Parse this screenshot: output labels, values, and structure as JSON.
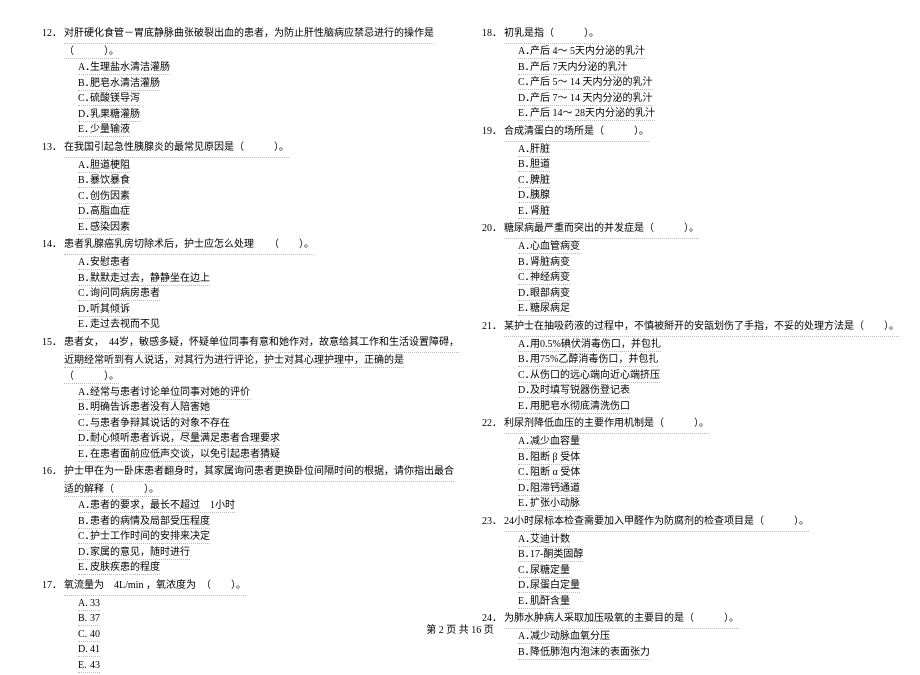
{
  "footer": "第 2 页 共 16 页",
  "left_questions": [
    {
      "num": "12．",
      "text": "对肝硬化食管－胃底静脉曲张破裂出血的患者，为防止肝性脑病应禁忌进行的操作是",
      "text2": "（　　　）。",
      "opts": [
        {
          "l": "A．",
          "t": "生理盐水清洁灌肠"
        },
        {
          "l": "B．",
          "t": "肥皂水清洁灌肠"
        },
        {
          "l": "C．",
          "t": "硫酸镁导泻"
        },
        {
          "l": "D．",
          "t": "乳果糖灌肠"
        },
        {
          "l": "E．",
          "t": "少量输液"
        }
      ]
    },
    {
      "num": "13．",
      "text": "在我国引起急性胰腺炎的最常见原因是（　　　）。",
      "opts": [
        {
          "l": "A．",
          "t": "胆道梗阻"
        },
        {
          "l": "B．",
          "t": "暴饮暴食"
        },
        {
          "l": "C．",
          "t": "创伤因素"
        },
        {
          "l": "D．",
          "t": "高脂血症"
        },
        {
          "l": "E．",
          "t": "感染因素"
        }
      ]
    },
    {
      "num": "14．",
      "text": "患者乳腺癌乳房切除术后，护士应怎么处理　　（　　）。",
      "opts": [
        {
          "l": "A．",
          "t": "安慰患者"
        },
        {
          "l": "B．",
          "t": "默默走过去，静静坐在边上"
        },
        {
          "l": "C．",
          "t": "询问同病房患者"
        },
        {
          "l": "D．",
          "t": "听其倾诉"
        },
        {
          "l": "E．",
          "t": "走过去视而不见"
        }
      ]
    },
    {
      "num": "15．",
      "text": "患者女，　44岁，敏感多疑，怀疑单位同事有意和她作对，故意给其工作和生活设置障碍，",
      "text2": "近期经常听到有人说话，对其行为进行评论，护士对其心理护理中，正确的是（　　　）。",
      "opts": [
        {
          "l": "A．",
          "t": "经常与患者讨论单位同事对她的评价"
        },
        {
          "l": "B．",
          "t": "明确告诉患者没有人陪害她"
        },
        {
          "l": "C．",
          "t": "与患者争辩其说话的对象不存在"
        },
        {
          "l": "D．",
          "t": "耐心倾听患者诉说，尽量满足患者合理要求"
        },
        {
          "l": "E．",
          "t": "在患者面前应低声交谈，以免引起患者猜疑"
        }
      ]
    },
    {
      "num": "16．",
      "text": "护士甲在为一卧床患者翻身时，其家属询问患者更换卧位间隔时间的根据，请你指出最合",
      "text2": "适的解释（　　　）。",
      "opts": [
        {
          "l": "A．",
          "t": "患者的要求，最长不超过　1小时"
        },
        {
          "l": "B．",
          "t": "患者的病情及局部受压程度"
        },
        {
          "l": "C．",
          "t": "护士工作时间的安排来决定"
        },
        {
          "l": "D．",
          "t": "家属的意见，随时进行"
        },
        {
          "l": "E．",
          "t": "皮肤疾患的程度"
        }
      ]
    },
    {
      "num": "17．",
      "text": "氧流量为　4L/min ，氧浓度为　（　　）。",
      "opts": [
        {
          "l": "A.",
          "t": "33"
        },
        {
          "l": "B.",
          "t": "37"
        },
        {
          "l": "C.",
          "t": "40"
        },
        {
          "l": "D.",
          "t": "41"
        },
        {
          "l": "E.",
          "t": "43"
        }
      ]
    }
  ],
  "right_questions": [
    {
      "num": "18．",
      "text": "初乳是指（　　　）。",
      "opts": [
        {
          "l": "A．",
          "t": "产后 4～ 5天内分泌的乳汁"
        },
        {
          "l": "B．",
          "t": "产后 7天内分泌的乳汁"
        },
        {
          "l": "C．",
          "t": "产后 5～ 14 天内分泌的乳汁"
        },
        {
          "l": "D．",
          "t": "产后 7～ 14 天内分泌的乳汁"
        },
        {
          "l": "E．",
          "t": "产后 14～ 28天内分泌的乳汁"
        }
      ]
    },
    {
      "num": "19．",
      "text": "合成清蛋白的场所是（　　　）。",
      "opts": [
        {
          "l": "A．",
          "t": "肝脏"
        },
        {
          "l": "B．",
          "t": "胆道"
        },
        {
          "l": "C．",
          "t": "脾脏"
        },
        {
          "l": "D．",
          "t": "胰腺"
        },
        {
          "l": "E．",
          "t": "肾脏"
        }
      ]
    },
    {
      "num": "20．",
      "text": "糖尿病最严重而突出的并发症是（　　　）。",
      "opts": [
        {
          "l": "A．",
          "t": "心血管病变"
        },
        {
          "l": "B．",
          "t": "肾脏病变"
        },
        {
          "l": "C．",
          "t": "神经病变"
        },
        {
          "l": "D．",
          "t": "眼部病变"
        },
        {
          "l": "E．",
          "t": "糖尿病足"
        }
      ]
    },
    {
      "num": "21．",
      "text": "某护士在抽吸药液的过程中，不慎被掰开的安瓿划伤了手指，不妥的处理方法是（　　）。",
      "opts": [
        {
          "l": "A．",
          "t": "用0.5%碘伏消毒伤口，并包扎"
        },
        {
          "l": "B．",
          "t": "用75%乙醇消毒伤口，并包扎"
        },
        {
          "l": "C．",
          "t": "从伤口的远心端向近心端挤压"
        },
        {
          "l": "D．",
          "t": "及时填写锐器伤登记表"
        },
        {
          "l": "E．",
          "t": "用肥皂水彻底清洗伤口"
        }
      ]
    },
    {
      "num": "22．",
      "text": "利尿剂降低血压的主要作用机制是（　　　）。",
      "opts": [
        {
          "l": "A．",
          "t": "减少血容量"
        },
        {
          "l": "B．",
          "t": "阻断 β 受体"
        },
        {
          "l": "C．",
          "t": "阻断 α 受体"
        },
        {
          "l": "D．",
          "t": "阻滞钙通道"
        },
        {
          "l": "E．",
          "t": "扩张小动脉"
        }
      ]
    },
    {
      "num": "23．",
      "text": "24小时尿标本检查需要加入甲醛作为防腐剂的检查项目是（　　　）。",
      "opts": [
        {
          "l": "A．",
          "t": "艾迪计数"
        },
        {
          "l": "B．",
          "t": "17-酮类固醇"
        },
        {
          "l": "C．",
          "t": "尿糖定量"
        },
        {
          "l": "D．",
          "t": "尿蛋白定量"
        },
        {
          "l": "E．",
          "t": "肌酐含量"
        }
      ]
    },
    {
      "num": "24．",
      "text": "为肺水肿病人采取加压吸氧的主要目的是（　　　）。",
      "opts": [
        {
          "l": "A．",
          "t": "减少动脉血氧分压"
        },
        {
          "l": "B．",
          "t": "降低肺泡内泡沫的表面张力"
        }
      ]
    }
  ]
}
